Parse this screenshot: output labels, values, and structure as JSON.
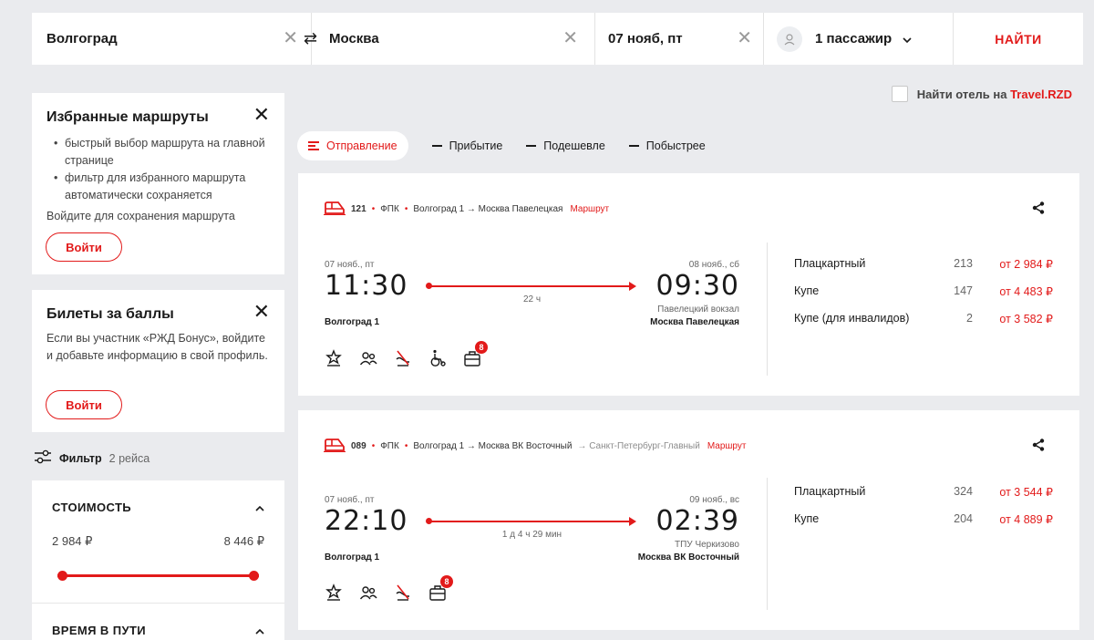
{
  "search": {
    "from": "Волгоград",
    "to": "Москва",
    "date": "07 нояб, пт",
    "passengers": "1 пассажир",
    "find_label": "НАЙТИ",
    "clear_glyph": "✕",
    "swap_glyph": "⇄"
  },
  "favorites": {
    "title": "Избранные маршруты",
    "items": [
      "быстрый выбор маршрута на главной странице",
      "фильтр для избранного маршрута автоматически сохраняется"
    ],
    "hint": "Войдите для сохранения маршрута",
    "login": "Войти"
  },
  "bonus": {
    "title": "Билеты за баллы",
    "text": "Если вы участник «РЖД Бонус», войдите и добавьте информацию в свой профиль.",
    "login": "Войти"
  },
  "filter": {
    "label": "Фильтр",
    "count": "2 рейса"
  },
  "cost": {
    "title": "СТОИМОСТЬ",
    "min": "2 984 ₽",
    "max": "8 446 ₽",
    "range_min_frac": 0,
    "range_max_frac": 1
  },
  "duration": {
    "title": "ВРЕМЯ В ПУТИ"
  },
  "hotel": {
    "label": "Найти отель на ",
    "brand": "Travel.RZD"
  },
  "sort": [
    {
      "label": "Отправление",
      "active": true
    },
    {
      "label": "Прибытие",
      "active": false
    },
    {
      "label": "Подешевле",
      "active": false
    },
    {
      "label": "Побыстрее",
      "active": false
    }
  ],
  "trains": [
    {
      "number": "121",
      "carrier": "ФПК",
      "route": "Волгоград 1 → Москва Павелецкая",
      "via": "",
      "route_link": "Маршрут",
      "dep_date": "07 нояб., пт",
      "dep_time": "11:30",
      "arr_date": "08 нояб., сб",
      "arr_time": "09:30",
      "duration": "22 ч",
      "from_station": "Волгоград 1",
      "to_station_alt": "Павелецкий вокзал",
      "to_station": "Москва Павелецкая",
      "bag_badge": "8",
      "amenities": [
        "star-icon",
        "people-icon",
        "no-pets-icon",
        "wheelchair-icon",
        "luggage-icon"
      ],
      "fares": [
        {
          "class": "Плацкартный",
          "seats": "213",
          "price": "от 2 984 ₽"
        },
        {
          "class": "Купе",
          "seats": "147",
          "price": "от 4 483 ₽"
        },
        {
          "class": "Купе (для инвалидов)",
          "seats": "2",
          "price": "от 3 582 ₽"
        }
      ]
    },
    {
      "number": "089",
      "carrier": "ФПК",
      "route": "Волгоград 1 → Москва ВК Восточный",
      "via": "→ Санкт-Петербург-Главный",
      "route_link": "Маршрут",
      "dep_date": "07 нояб., пт",
      "dep_time": "22:10",
      "arr_date": "09 нояб., вс",
      "arr_time": "02:39",
      "duration": "1 д 4 ч 29 мин",
      "from_station": "Волгоград 1",
      "to_station_alt": "ТПУ Черкизово",
      "to_station": "Москва ВК Восточный",
      "bag_badge": "8",
      "amenities": [
        "star-icon",
        "people-icon",
        "no-pets-icon",
        "luggage-icon"
      ],
      "fares": [
        {
          "class": "Плацкартный",
          "seats": "324",
          "price": "от 3 544 ₽"
        },
        {
          "class": "Купе",
          "seats": "204",
          "price": "от 4 889 ₽"
        }
      ]
    }
  ],
  "colors": {
    "accent": "#e21a1a",
    "background": "#eaebee",
    "card": "#ffffff"
  }
}
